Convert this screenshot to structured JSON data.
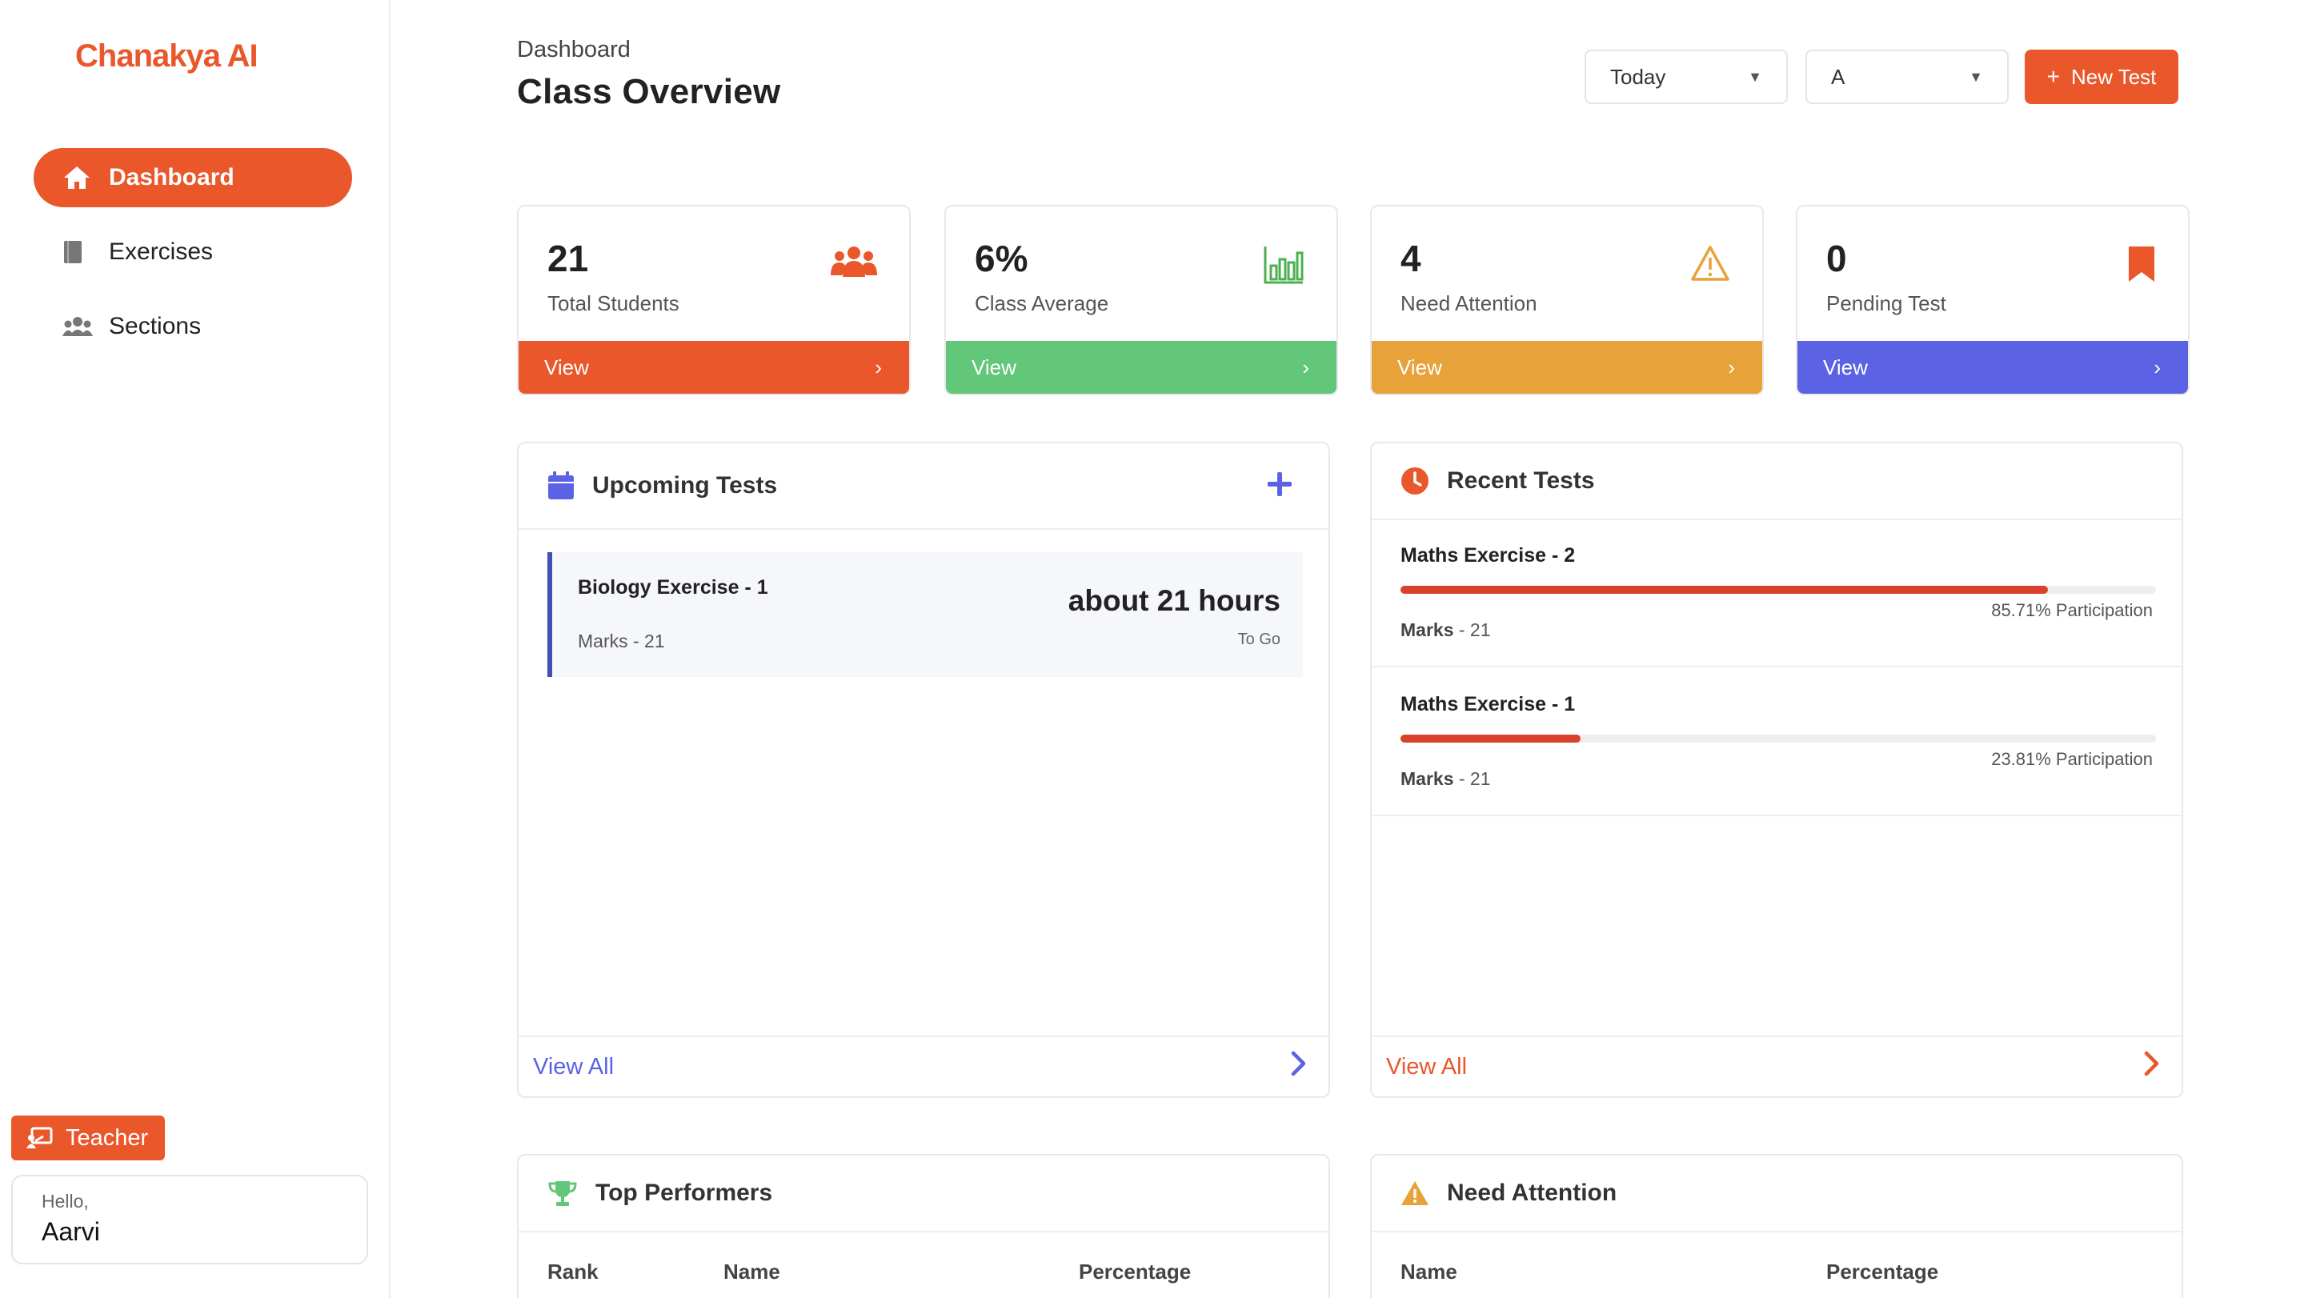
{
  "app": {
    "logo": "Chanakya AI"
  },
  "sidebar": {
    "items": [
      {
        "label": "Dashboard",
        "icon": "home-icon"
      },
      {
        "label": "Exercises",
        "icon": "book-icon"
      },
      {
        "label": "Sections",
        "icon": "users-icon"
      }
    ],
    "role_label": "Teacher",
    "greeting": "Hello,",
    "user_name": "Aarvi"
  },
  "header": {
    "breadcrumb": "Dashboard",
    "title": "Class Overview",
    "period_select": "Today",
    "section_select": "A",
    "new_test_label": "New Test"
  },
  "stats": [
    {
      "value": "21",
      "label": "Total Students",
      "action": "View",
      "color": "#e9572b",
      "icon": "users-icon"
    },
    {
      "value": "6%",
      "label": "Class Average",
      "action": "View",
      "color": "#63c77a",
      "icon": "bar-chart-icon"
    },
    {
      "value": "4",
      "label": "Need Attention",
      "action": "View",
      "color": "#e8a23a",
      "icon": "warning-icon"
    },
    {
      "value": "0",
      "label": "Pending Test",
      "action": "View",
      "color": "#5b63e4",
      "icon": "bookmark-icon"
    }
  ],
  "upcoming": {
    "title": "Upcoming Tests",
    "items": [
      {
        "name": "Biology Exercise - 1",
        "marks": "Marks - 21",
        "time": "about 21 hours",
        "sub": "To Go"
      }
    ],
    "view_all": "View All"
  },
  "recent": {
    "title": "Recent Tests",
    "items": [
      {
        "name": "Maths Exercise - 2",
        "participation_text": "85.71% Participation",
        "participation": 85.71,
        "marks_label": "Marks",
        "marks_value": " - 21"
      },
      {
        "name": "Maths Exercise - 1",
        "participation_text": "23.81% Participation",
        "participation": 23.81,
        "marks_label": "Marks",
        "marks_value": " - 21"
      }
    ],
    "view_all": "View All"
  },
  "top_performers": {
    "title": "Top Performers",
    "columns": [
      "Rank",
      "Name",
      "Percentage"
    ]
  },
  "need_attention": {
    "title": "Need Attention",
    "columns": [
      "Name",
      "Percentage"
    ]
  },
  "colors": {
    "brand": "#e9572b",
    "indigo": "#5b63e4",
    "green": "#63c77a",
    "amber": "#e8a23a",
    "progress": "#d9412b"
  }
}
